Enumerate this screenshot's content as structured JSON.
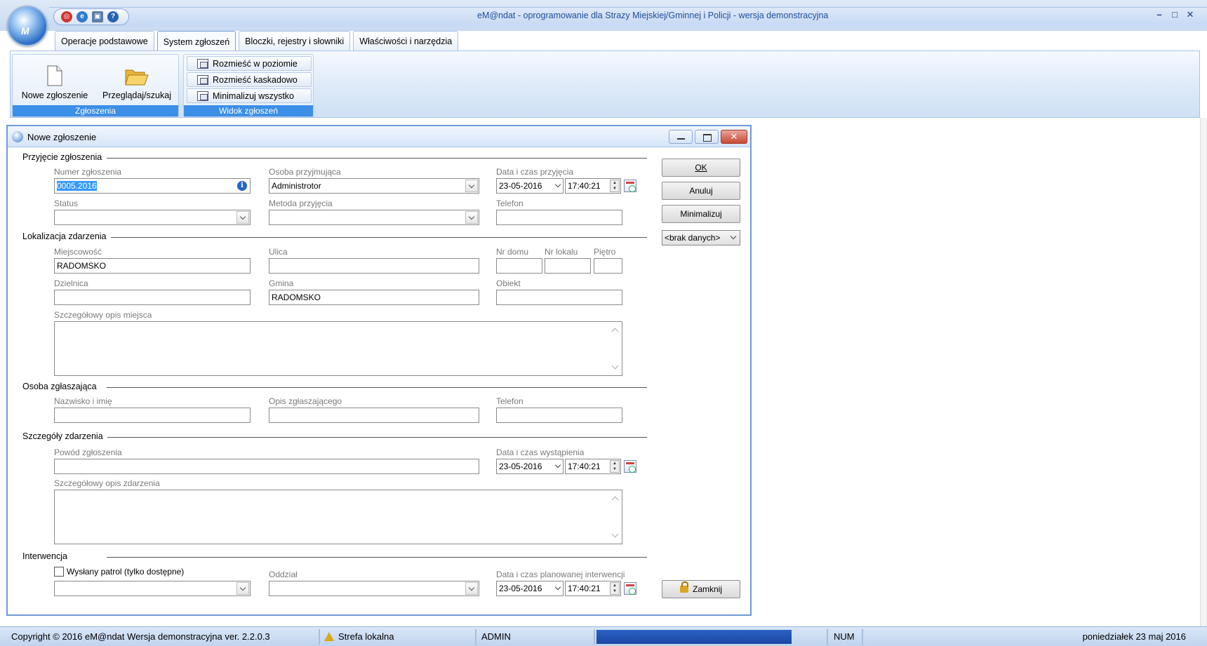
{
  "app": {
    "title": "eM@ndat - oprogramowanie dla Strazy Miejskiej/Gminnej i Policji - wersja demonstracyjna",
    "orb_text": "M"
  },
  "tabs": [
    {
      "label": "Operacje podstawowe"
    },
    {
      "label": "System zgłoszeń"
    },
    {
      "label": "Bloczki, rejestry i słowniki"
    },
    {
      "label": "Właściwości i narzędzia"
    }
  ],
  "ribbon": {
    "group1_label": "Zgłoszenia",
    "new_label": "Nowe zgłoszenie",
    "browse_label": "Przeglądaj/szukaj",
    "group2_label": "Widok zgłoszeń",
    "tile_label": "Rozmieść w poziomie",
    "cascade_label": "Rozmieść kaskadowo",
    "minimize_all_label": "Minimalizuj wszystko"
  },
  "dialog": {
    "title": "Nowe zgłoszenie",
    "sections": {
      "reception": "Przyjęcie zgłoszenia",
      "location": "Lokalizacja zdarzenia",
      "reporter": "Osoba zgłaszająca",
      "details": "Szczegóły zdarzenia",
      "intervention": "Interwencja"
    },
    "labels": {
      "number": "Numer zgłoszenia",
      "receiver": "Osoba przyjmująca",
      "received_dt": "Data i czas przyjęcia",
      "status": "Status",
      "method": "Metoda przyjęcia",
      "phone": "Telefon",
      "city": "Miejscowość",
      "street": "Ulica",
      "house_no": "Nr domu",
      "flat_no": "Nr lokalu",
      "floor": "Piętro",
      "district": "Dzielnica",
      "commune": "Gmina",
      "object": "Obiekt",
      "place_desc": "Szczegółowy opis miejsca",
      "reporter_name": "Nazwisko i imię",
      "reporter_desc": "Opis zgłaszającego",
      "reporter_phone": "Telefon",
      "reason": "Powód zgłoszenia",
      "occurred_dt": "Data i czas wystąpienia",
      "event_desc": "Szczegółowy opis zdarzenia",
      "patrol_sent": "Wysłany patrol  (tylko dostępne)",
      "unit": "Oddział",
      "planned_dt": "Data i czas planowanej interwencji"
    },
    "values": {
      "number": "0005.2016",
      "receiver": "Administrotor",
      "received_date": "23-05-2016",
      "received_time": "17:40:21",
      "city": "RADOMSKO",
      "commune": "RADOMSKO",
      "occurred_date": "23-05-2016",
      "occurred_time": "17:40:21",
      "planned_date": "23-05-2016",
      "planned_time": "17:40:21"
    },
    "buttons": {
      "ok": "OK",
      "cancel": "Anuluj",
      "minimize": "Minimalizuj",
      "no_data": "<brak danych>",
      "close": "Zamknij"
    }
  },
  "statusbar": {
    "copyright": "Copyright © 2016 eM@ndat  Wersja demonstracyjna   ver. 2.2.0.3",
    "zone": "Strefa lokalna",
    "user": "ADMIN",
    "num": "NUM",
    "date": "poniedziałek 23 maj 2016"
  }
}
